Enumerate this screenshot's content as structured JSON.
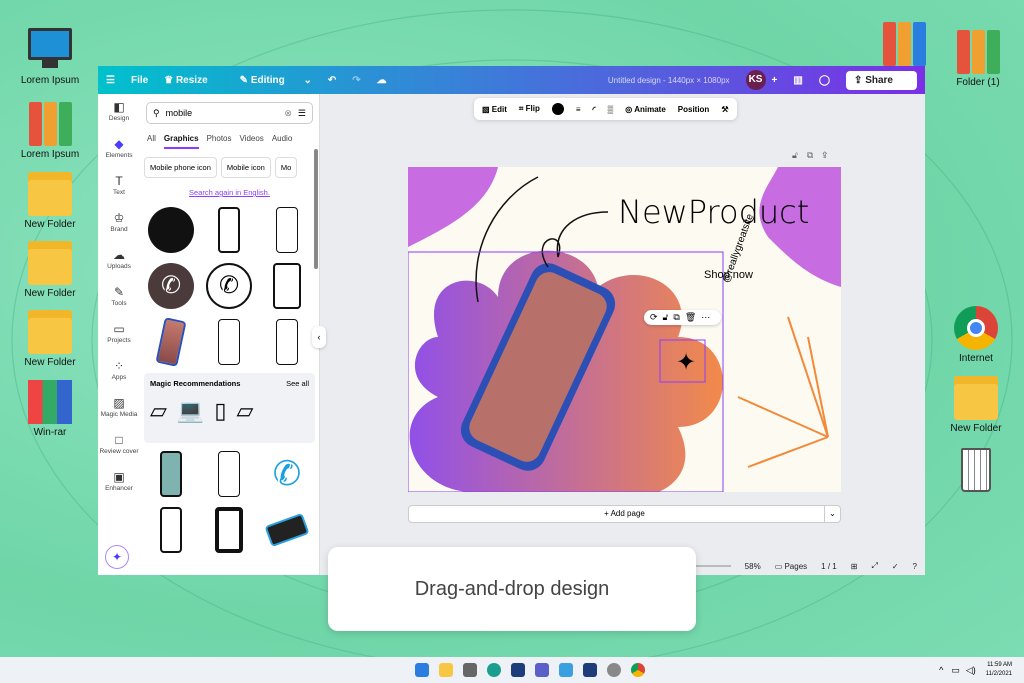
{
  "desktop": {
    "left": [
      "Lorem Ipsum",
      "Lorem Ipsum",
      "New Folder",
      "New Folder",
      "New Folder",
      "Win-rar"
    ],
    "right": [
      "Folder (1)",
      "Internet",
      "New Folder"
    ]
  },
  "app": {
    "menu": {
      "file": "File",
      "resize": "Resize",
      "editing": "Editing"
    },
    "title": "Untitled design - 1440px × 1080px",
    "avatar": "KS",
    "share": "Share",
    "rail": [
      "Design",
      "Elements",
      "Text",
      "Brand",
      "Uploads",
      "Tools",
      "Projects",
      "Apps",
      "Magic Media",
      "Review cover",
      "Enhancer"
    ],
    "search": {
      "value": "mobile"
    },
    "tabs": [
      "All",
      "Graphics",
      "Photos",
      "Videos",
      "Audio"
    ],
    "chips": [
      "Mobile phone icon",
      "Mobile icon",
      "Mo"
    ],
    "search_english": "Search again in English.",
    "magic_title": "Magic Recommendations",
    "see_all": "See all",
    "toolbar": {
      "edit": "Edit",
      "flip": "Flip",
      "animate": "Animate",
      "position": "Position"
    },
    "design": {
      "headline": "NewProduct",
      "shop": "Shop now",
      "handle": "@reallygreatsite"
    },
    "add_page": "+ Add page",
    "zoom": "58%",
    "pages": "Pages",
    "page_count": "1 / 1"
  },
  "caption": "Drag-and-drop design",
  "taskbar": {
    "time": "11:59 AM",
    "date": "11/2/2021"
  }
}
